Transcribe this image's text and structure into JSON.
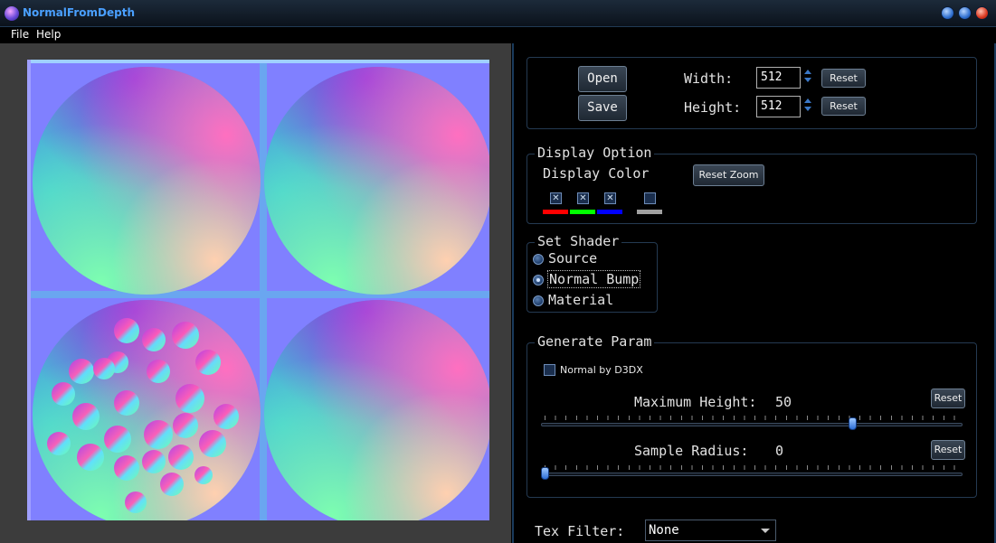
{
  "window": {
    "title": "NormalFromDepth"
  },
  "menu": {
    "file": "File",
    "help": "Help"
  },
  "io": {
    "open_label": "Open",
    "save_label": "Save",
    "width_label": "Width:",
    "width_value": "512",
    "height_label": "Height:",
    "height_value": "512",
    "reset_label": "Reset"
  },
  "display": {
    "group_title": "Display Option",
    "color_label": "Display Color",
    "reset_zoom_label": "Reset Zoom",
    "channels": [
      {
        "name": "red",
        "checked": true,
        "color": "#ff0000"
      },
      {
        "name": "green",
        "checked": true,
        "color": "#00ff00"
      },
      {
        "name": "blue",
        "checked": true,
        "color": "#0000ff"
      },
      {
        "name": "alpha",
        "checked": false,
        "color": "#a0a0a0"
      }
    ]
  },
  "shader": {
    "group_title": "Set Shader",
    "options": [
      "Source",
      "Normal Bump",
      "Material"
    ],
    "selected": "Normal Bump"
  },
  "generate": {
    "group_title": "Generate Param",
    "d3dx_label": "Normal by D3DX",
    "d3dx_checked": false,
    "max_height_label": "Maximum Height:",
    "max_height_value": "50",
    "sample_radius_label": "Sample Radius:",
    "sample_radius_value": "0",
    "reset_label": "Reset",
    "max_height_fraction": 0.745,
    "sample_radius_fraction": 0.0
  },
  "tex_filter": {
    "label": "Tex Filter:",
    "value": "None"
  },
  "colors": {
    "accent": "#4aa0ff",
    "normal_flat": "#8080ff"
  }
}
